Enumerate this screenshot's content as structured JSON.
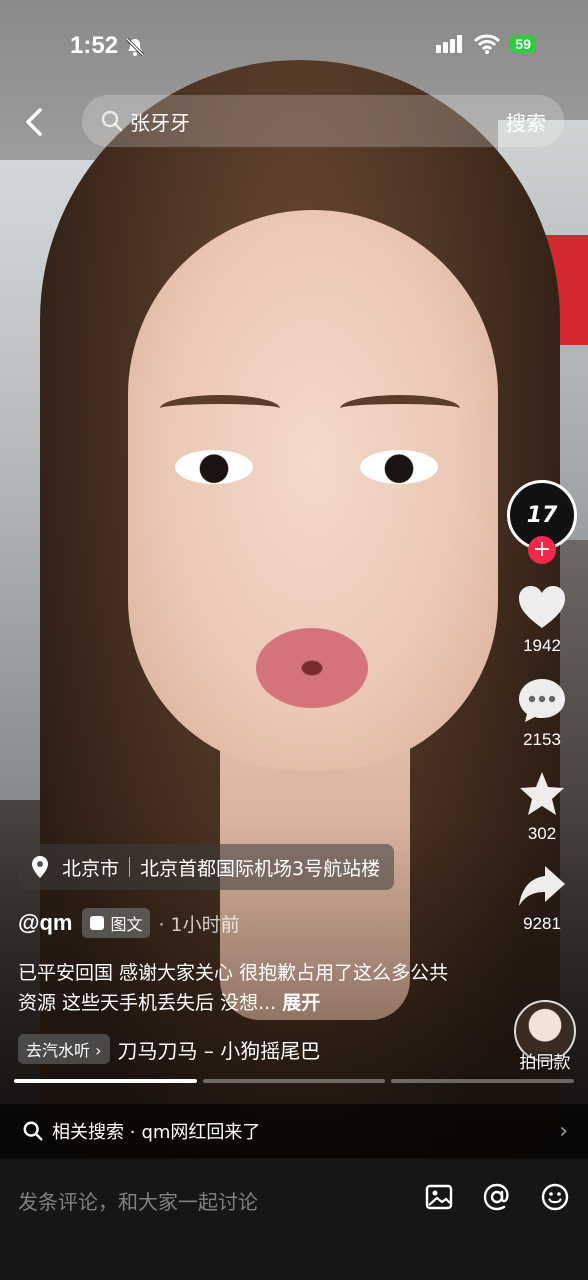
{
  "status_bar": {
    "time": "1:52",
    "battery": "59"
  },
  "search": {
    "query": "张牙牙",
    "button": "搜索"
  },
  "rail": {
    "avatar_text": "17",
    "likes": "1942",
    "comments": "2153",
    "favorites": "302",
    "shares": "9281",
    "shoot_same": "拍同款"
  },
  "location": {
    "city": "北京市",
    "place": "北京首都国际机场3号航站楼"
  },
  "post": {
    "author": "@qm",
    "type": "图文",
    "time_ago": "· 1小时前",
    "caption": "已平安回国 感谢大家关心 很抱歉占用了这么多公共资源 这些天手机丢失后 没想...",
    "expand": "展开"
  },
  "music": {
    "chip": "去汽水听",
    "name": "刀马刀马 – 小狗摇尾巴"
  },
  "progress": {
    "segments": 3,
    "active_segment": 1,
    "active_fill": 1.0
  },
  "related": {
    "label": "相关搜索 ·",
    "term": "qm网红回来了"
  },
  "comment": {
    "placeholder": "发条评论，和大家一起讨论"
  },
  "colors": {
    "accent": "#f2294d",
    "battery": "#2ecc40"
  }
}
